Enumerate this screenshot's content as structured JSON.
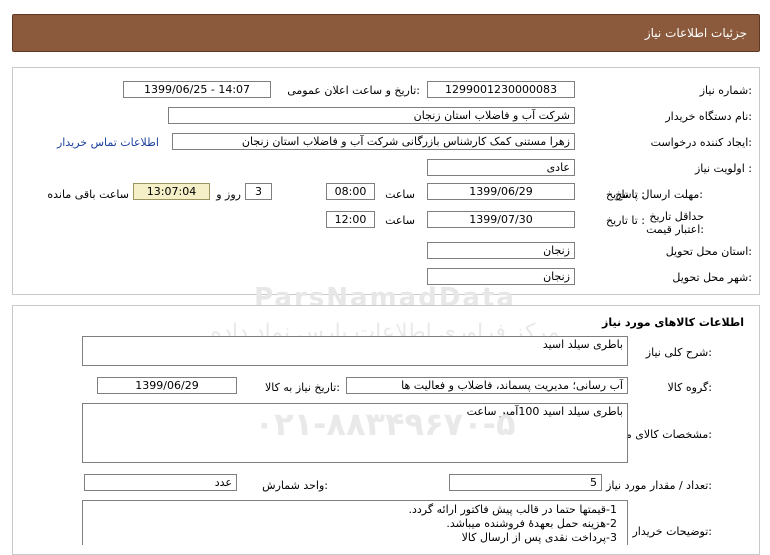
{
  "header": {
    "title": "جزئیات اطلاعات نیاز"
  },
  "need": {
    "need_number_label": "شماره نیاز:",
    "need_number": "1299001230000083",
    "announce_label": "تاریخ و ساعت اعلان عمومی:",
    "announce_value": "1399/06/25 - 14:07",
    "buyer_label": "نام دستگاه خریدار:",
    "buyer_value": "شرکت آب و فاضلاب استان زنجان",
    "creator_label": "ایجاد کننده درخواست:",
    "creator_value": "زهرا مستنی کمک کارشناس بازرگانی شرکت آب و فاضلاب استان زنجان",
    "contact_link": "اطلاعات تماس خریدار",
    "priority_label": "اولویت نیاز :",
    "priority_value": "عادی",
    "reply_deadline_label": "مهلت ارسال پاسخ:",
    "to_date_label": "تا تاریخ :",
    "reply_date": "1399/06/29",
    "time_label": "ساعت",
    "reply_time": "08:00",
    "days_value": "3",
    "days_label": "روز و",
    "remaining_time": "13:07:04",
    "remaining_label": "ساعت باقی مانده",
    "validity_label": "حداقل تاریخ اعتبار قیمت:",
    "validity_date": "1399/07/30",
    "validity_time": "12:00",
    "province_label": "استان محل تحویل:",
    "province_value": "زنجان",
    "city_label": "شهر محل تحویل:",
    "city_value": "زنجان"
  },
  "goods": {
    "section_title": "اطلاعات کالاهای مورد نیاز",
    "summary_label": "شرح کلی نیاز:",
    "summary_value": "باطری سیلد اسید",
    "group_label": "گروه کالا:",
    "group_value": "آب رسانی؛ مدیریت پسماند، فاضلاب و فعالیت ها",
    "need_date_label": "تاریخ نیاز به کالا:",
    "need_date": "1399/06/29",
    "spec_label": "مشخصات کالای مورد نیاز:",
    "spec_value": "باطری سیلد اسید 100آمپر ساعت",
    "qty_label": "تعداد / مقدار مورد نیاز:",
    "qty_value": "5",
    "unit_label": "واحد شمارش:",
    "unit_value": "عدد",
    "notes_label": "توضیحات خریدار:",
    "notes": [
      "1-قیمتها حتما در قالب پیش فاکتور ارائه گردد.",
      "2-هزینه حمل بعهدهٔ فروشنده میباشد.",
      "3-پرداخت نقدی پس از ارسال کالا"
    ]
  },
  "watermark": {
    "brand": "ParsNamadData",
    "persian": "مرکز فراوری اطلاعات پارس نماد داده ها",
    "phone": "۰۲۱-۸۸۳۴۹۶۷۰-۵"
  }
}
